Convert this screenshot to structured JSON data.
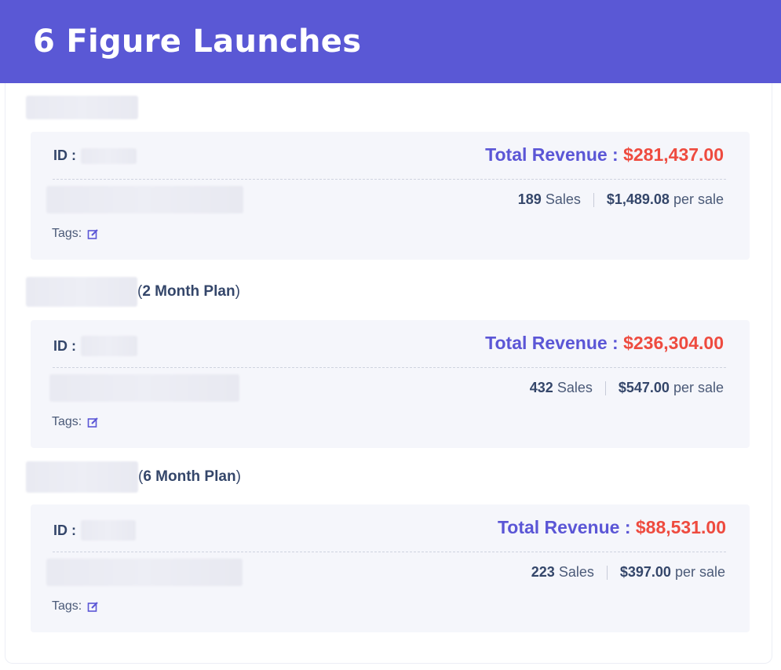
{
  "header": {
    "title": "6 Figure Launches"
  },
  "id_label": "ID :",
  "revenue_label": "Total Revenue :",
  "sales_suffix": "Sales",
  "per_sale_suffix": "per sale",
  "tags_label": "Tags:",
  "products": [
    {
      "plan": "",
      "revenue": "$281,437.00",
      "sales": "189",
      "per_sale": "$1,489.08"
    },
    {
      "plan": "2 Month Plan",
      "revenue": "$236,304.00",
      "sales": "432",
      "per_sale": "$547.00"
    },
    {
      "plan": "6 Month Plan",
      "revenue": "$88,531.00",
      "sales": "223",
      "per_sale": "$397.00"
    }
  ],
  "icons": {
    "edit": "edit-icon"
  },
  "colors": {
    "header_bg": "#5a58d5",
    "revenue_label": "#5b56d6",
    "revenue_value": "#ee4b3f",
    "card_bg": "#f5f6fb"
  }
}
